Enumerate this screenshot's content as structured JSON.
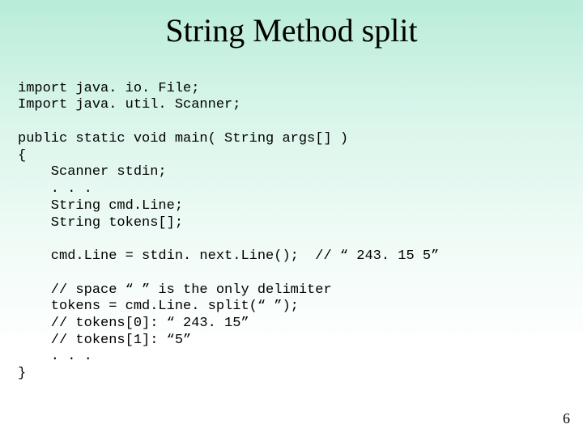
{
  "title": "String Method split",
  "code_lines": [
    "import java. io. File;",
    "Import java. util. Scanner;",
    "",
    "public static void main( String args[] )",
    "{",
    "    Scanner stdin;",
    "    . . .",
    "    String cmd.Line;",
    "    String tokens[];",
    "",
    "    cmd.Line = stdin. next.Line();  // “ 243. 15 5”",
    "",
    "    // space “ ” is the only delimiter",
    "    tokens = cmd.Line. split(“ ”);",
    "    // tokens[0]: “ 243. 15”",
    "    // tokens[1]: “5”",
    "    . . .",
    "}"
  ],
  "page_number": "6"
}
